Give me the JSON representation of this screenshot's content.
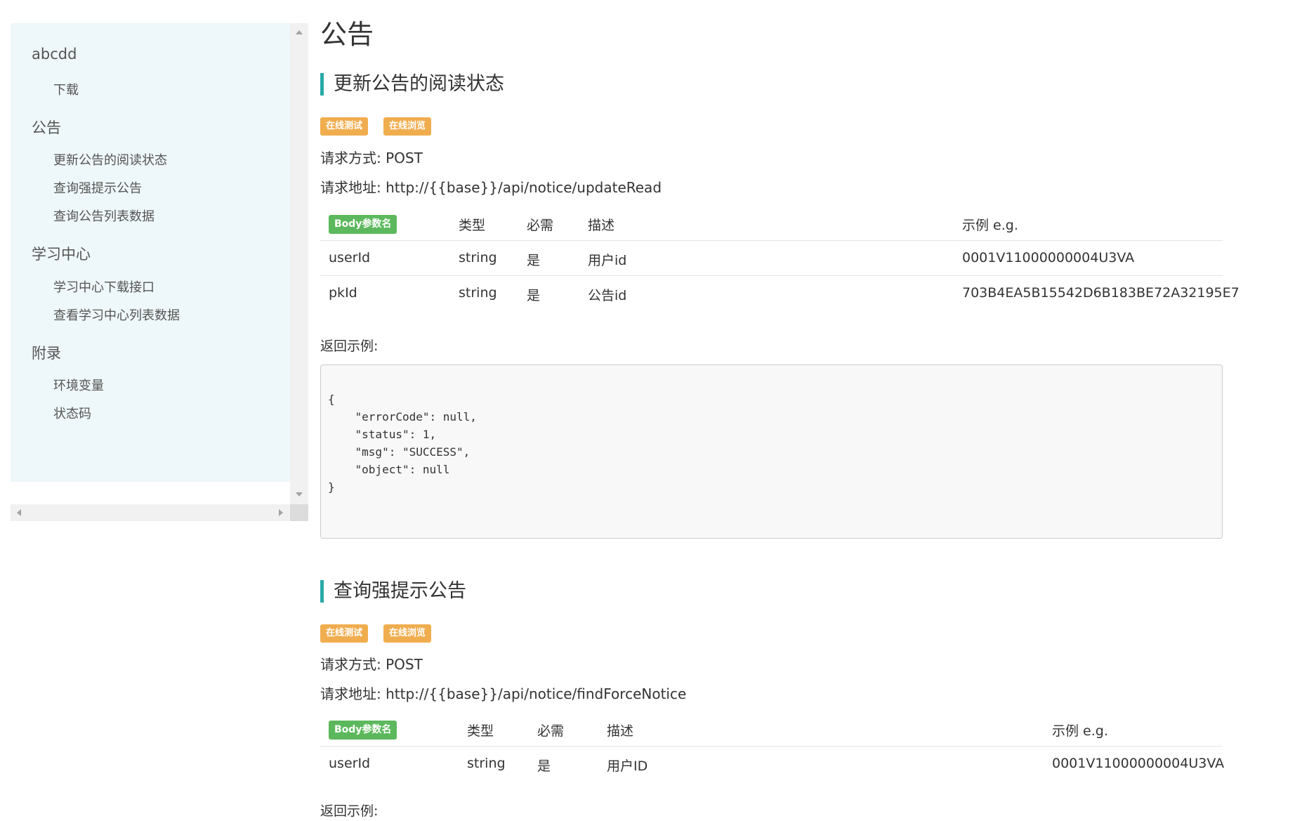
{
  "sidebar": {
    "groups": [
      {
        "label": "abcdd",
        "items": [
          "下载"
        ]
      },
      {
        "label": "公告",
        "items": [
          "更新公告的阅读状态",
          "查询强提示公告",
          "查询公告列表数据"
        ]
      },
      {
        "label": "学习中心",
        "items": [
          "学习中心下载接口",
          "查看学习中心列表数据"
        ]
      },
      {
        "label": "附录",
        "items": [
          "环境变量",
          "状态码"
        ]
      }
    ]
  },
  "main": {
    "page_title": "公告",
    "badges": {
      "test": "在线测试",
      "browse": "在线浏览"
    },
    "method_label": "请求方式:",
    "url_label": "请求地址:",
    "return_label": "返回示例:",
    "table_headers": {
      "param": "Body参数名",
      "type": "类型",
      "required": "必需",
      "desc": "描述",
      "example": "示例 e.g."
    },
    "sections": [
      {
        "title": "更新公告的阅读状态",
        "method": "POST",
        "url": "http://{{base}}/api/notice/updateRead",
        "params": [
          {
            "name": "userId",
            "type": "string",
            "required": "是",
            "desc": "用户id",
            "example": "0001V11000000004U3VA"
          },
          {
            "name": "pkId",
            "type": "string",
            "required": "是",
            "desc": "公告id",
            "example": "703B4EA5B15542D6B183BE72A32195E7"
          }
        ],
        "response": "{\n    \"errorCode\": null,\n    \"status\": 1,\n    \"msg\": \"SUCCESS\",\n    \"object\": null\n}"
      },
      {
        "title": "查询强提示公告",
        "method": "POST",
        "url": "http://{{base}}/api/notice/findForceNotice",
        "params": [
          {
            "name": "userId",
            "type": "string",
            "required": "是",
            "desc": "用户ID",
            "example": "0001V11000000004U3VA"
          }
        ]
      }
    ]
  }
}
